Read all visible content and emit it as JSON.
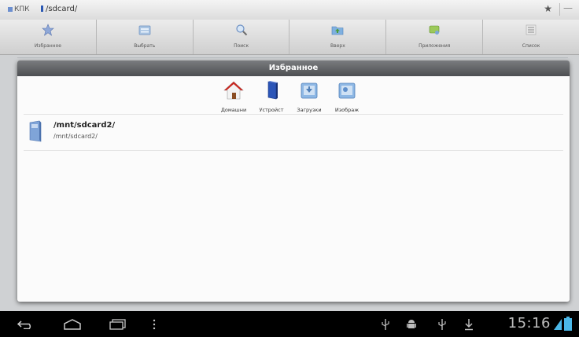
{
  "addressbar": {
    "root_label": "КПК",
    "path": "/sdcard/",
    "star": "★",
    "minus": "—"
  },
  "toolbar": {
    "buttons": [
      {
        "label": "Избранное",
        "icon": "star-icon"
      },
      {
        "label": "Выбрать",
        "icon": "select-icon"
      },
      {
        "label": "Поиск",
        "icon": "search-icon"
      },
      {
        "label": "Вверх",
        "icon": "folder-up-icon"
      },
      {
        "label": "Приложения",
        "icon": "apps-icon"
      },
      {
        "label": "Список",
        "icon": "list-icon"
      }
    ]
  },
  "dialog": {
    "title": "Избранное",
    "favorites": [
      {
        "label": "Домашни",
        "icon": "home-icon"
      },
      {
        "label": "Устройст",
        "icon": "device-icon"
      },
      {
        "label": "Загрузки",
        "icon": "downloads-icon"
      },
      {
        "label": "Изображ",
        "icon": "images-icon"
      }
    ],
    "entries": [
      {
        "name": "/mnt/sdcard2/",
        "path": "/mnt/sdcard2/",
        "icon": "sdcard-icon"
      }
    ]
  },
  "statusbar": {
    "time": "15:16",
    "colors": {
      "background": "#000000",
      "text": "#bdbdbd"
    }
  }
}
